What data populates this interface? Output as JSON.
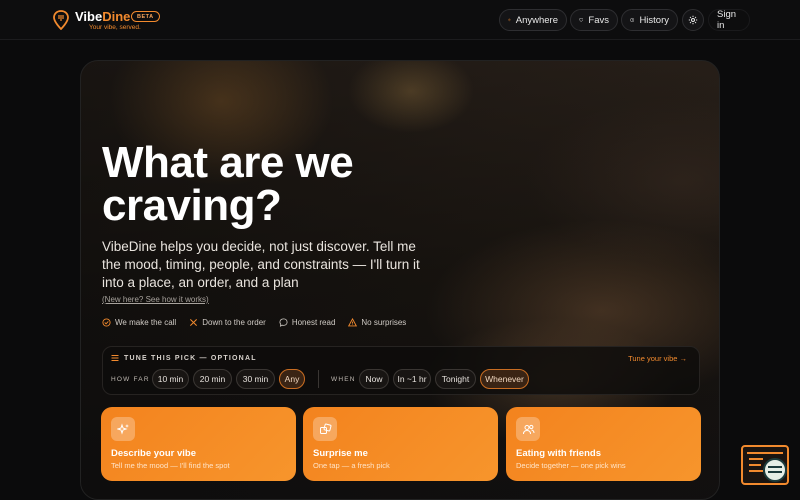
{
  "header": {
    "brand_main": "Vibe",
    "brand_accent": "Dine",
    "badge": "BETA",
    "tagline": "Your vibe, served.",
    "nav": [
      {
        "label": "Anywhere",
        "icon": "map-pin-icon"
      },
      {
        "label": "Favs",
        "icon": "heart-icon"
      },
      {
        "label": "History",
        "icon": "history-icon"
      }
    ],
    "settings_icon": "gear-icon",
    "signin": "Sign in"
  },
  "hero": {
    "title": "What are we craving?",
    "lead": "VibeDine helps you decide, not just discover. Tell me the mood, timing, people, and constraints — I'll turn it into a place, an order, and a plan",
    "how_link": "(New here? See how it works)",
    "features": [
      {
        "label": "We make the call",
        "icon": "check-circle-icon"
      },
      {
        "label": "Down to the order",
        "icon": "utensils-icon"
      },
      {
        "label": "Honest read",
        "icon": "chat-bubble-icon"
      },
      {
        "label": "No surprises",
        "icon": "warning-icon"
      }
    ]
  },
  "tune": {
    "title": "TUNE THIS PICK — OPTIONAL",
    "link": "Tune your vibe →",
    "how_far_label": "HOW FAR",
    "how_far_options": [
      "10 min",
      "20 min",
      "30 min",
      "Any"
    ],
    "how_far_selected": "Any",
    "when_label": "WHEN",
    "when_options": [
      "Now",
      "In ~1 hr",
      "Tonight",
      "Whenever"
    ],
    "when_selected": "Whenever"
  },
  "cards": [
    {
      "title": "Describe your vibe",
      "subtitle": "Tell me the mood — I'll find the spot",
      "icon": "sparkles-icon"
    },
    {
      "title": "Surprise me",
      "subtitle": "One tap — a fresh pick",
      "icon": "shuffle-icon"
    },
    {
      "title": "Eating with friends",
      "subtitle": "Decide together — one pick wins",
      "icon": "users-icon"
    }
  ],
  "colors": {
    "accent": "#f28a2e",
    "card": "#f3831e",
    "background": "#0b0b0c"
  }
}
